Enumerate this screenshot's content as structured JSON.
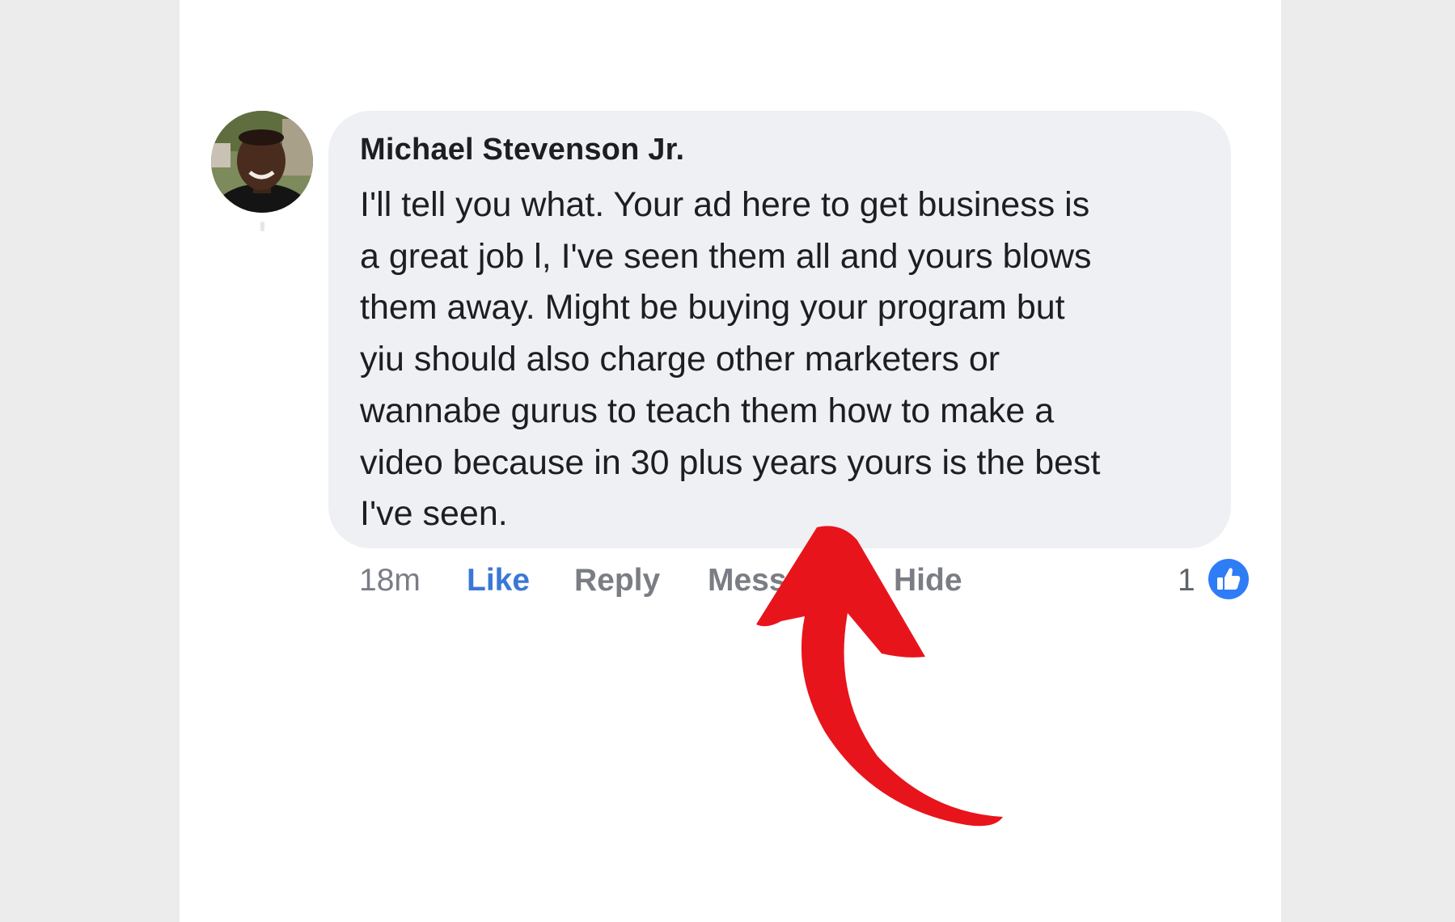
{
  "comment": {
    "author": "Michael Stevenson Jr.",
    "lines": [
      "I'll tell you what. Your ad here to get business is",
      "a great job l, I've seen them all and yours blows",
      "them away. Might be buying your program but",
      "yiu should also charge other marketers or",
      "wannabe gurus to teach them how to make a",
      "video because in 30 plus years yours is the best",
      "I've seen."
    ],
    "avatar_icon": "profile-photo"
  },
  "actions": {
    "time": "18m",
    "like": "Like",
    "reply": "Reply",
    "message": "Message",
    "hide": "Hide"
  },
  "reactions": {
    "count": "1",
    "icon": "thumbs-up-icon"
  },
  "annotation": {
    "icon": "red-arrow-icon",
    "color": "#e8141c"
  },
  "colors": {
    "like_blue": "#3a78d6",
    "bubble": "#eff0f4",
    "page_bg": "#ececec"
  }
}
